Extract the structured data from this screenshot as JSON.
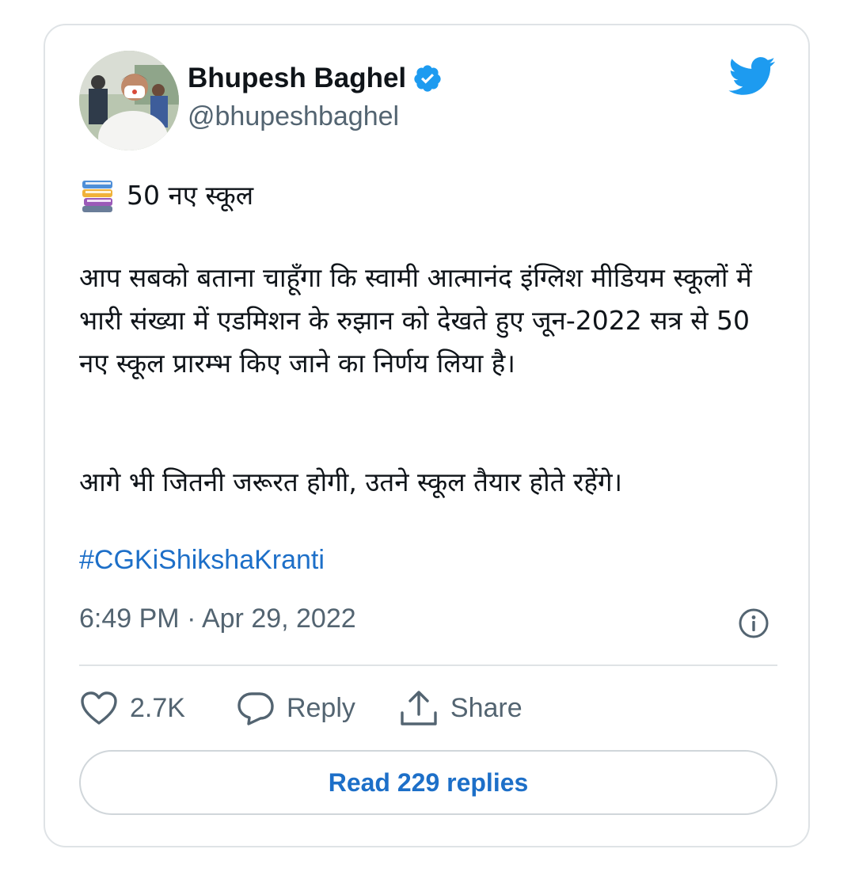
{
  "author": {
    "name": "Bhupesh Baghel",
    "handle": "@bhupeshbaghel",
    "verified": true
  },
  "tweet": {
    "emoji_icon": "books-icon",
    "line1": "50 नए स्कूल",
    "para1": "आप सबको बताना चाहूँगा कि स्वामी आत्मानंद इंग्लिश मीडियम स्कूलों में भारी संख्या में एडमिशन के रुझान को देखते हुए जून-2022 सत्र से 50 नए स्कूल प्रारम्भ किए जाने का निर्णय लिया है।",
    "para2": "आगे भी जितनी जरूरत होगी, उतने स्कूल तैयार होते रहेंगे।",
    "hashtag": "#CGKiShikshaKranti",
    "timestamp": "6:49 PM · Apr 29, 2022"
  },
  "actions": {
    "like_count": "2.7K",
    "reply_label": "Reply",
    "share_label": "Share"
  },
  "footer": {
    "read_replies_label": "Read 229 replies"
  },
  "colors": {
    "link": "#1d6fc8",
    "twitter_blue": "#1d9bf0",
    "muted": "#536471",
    "border": "#dfe3e6"
  }
}
